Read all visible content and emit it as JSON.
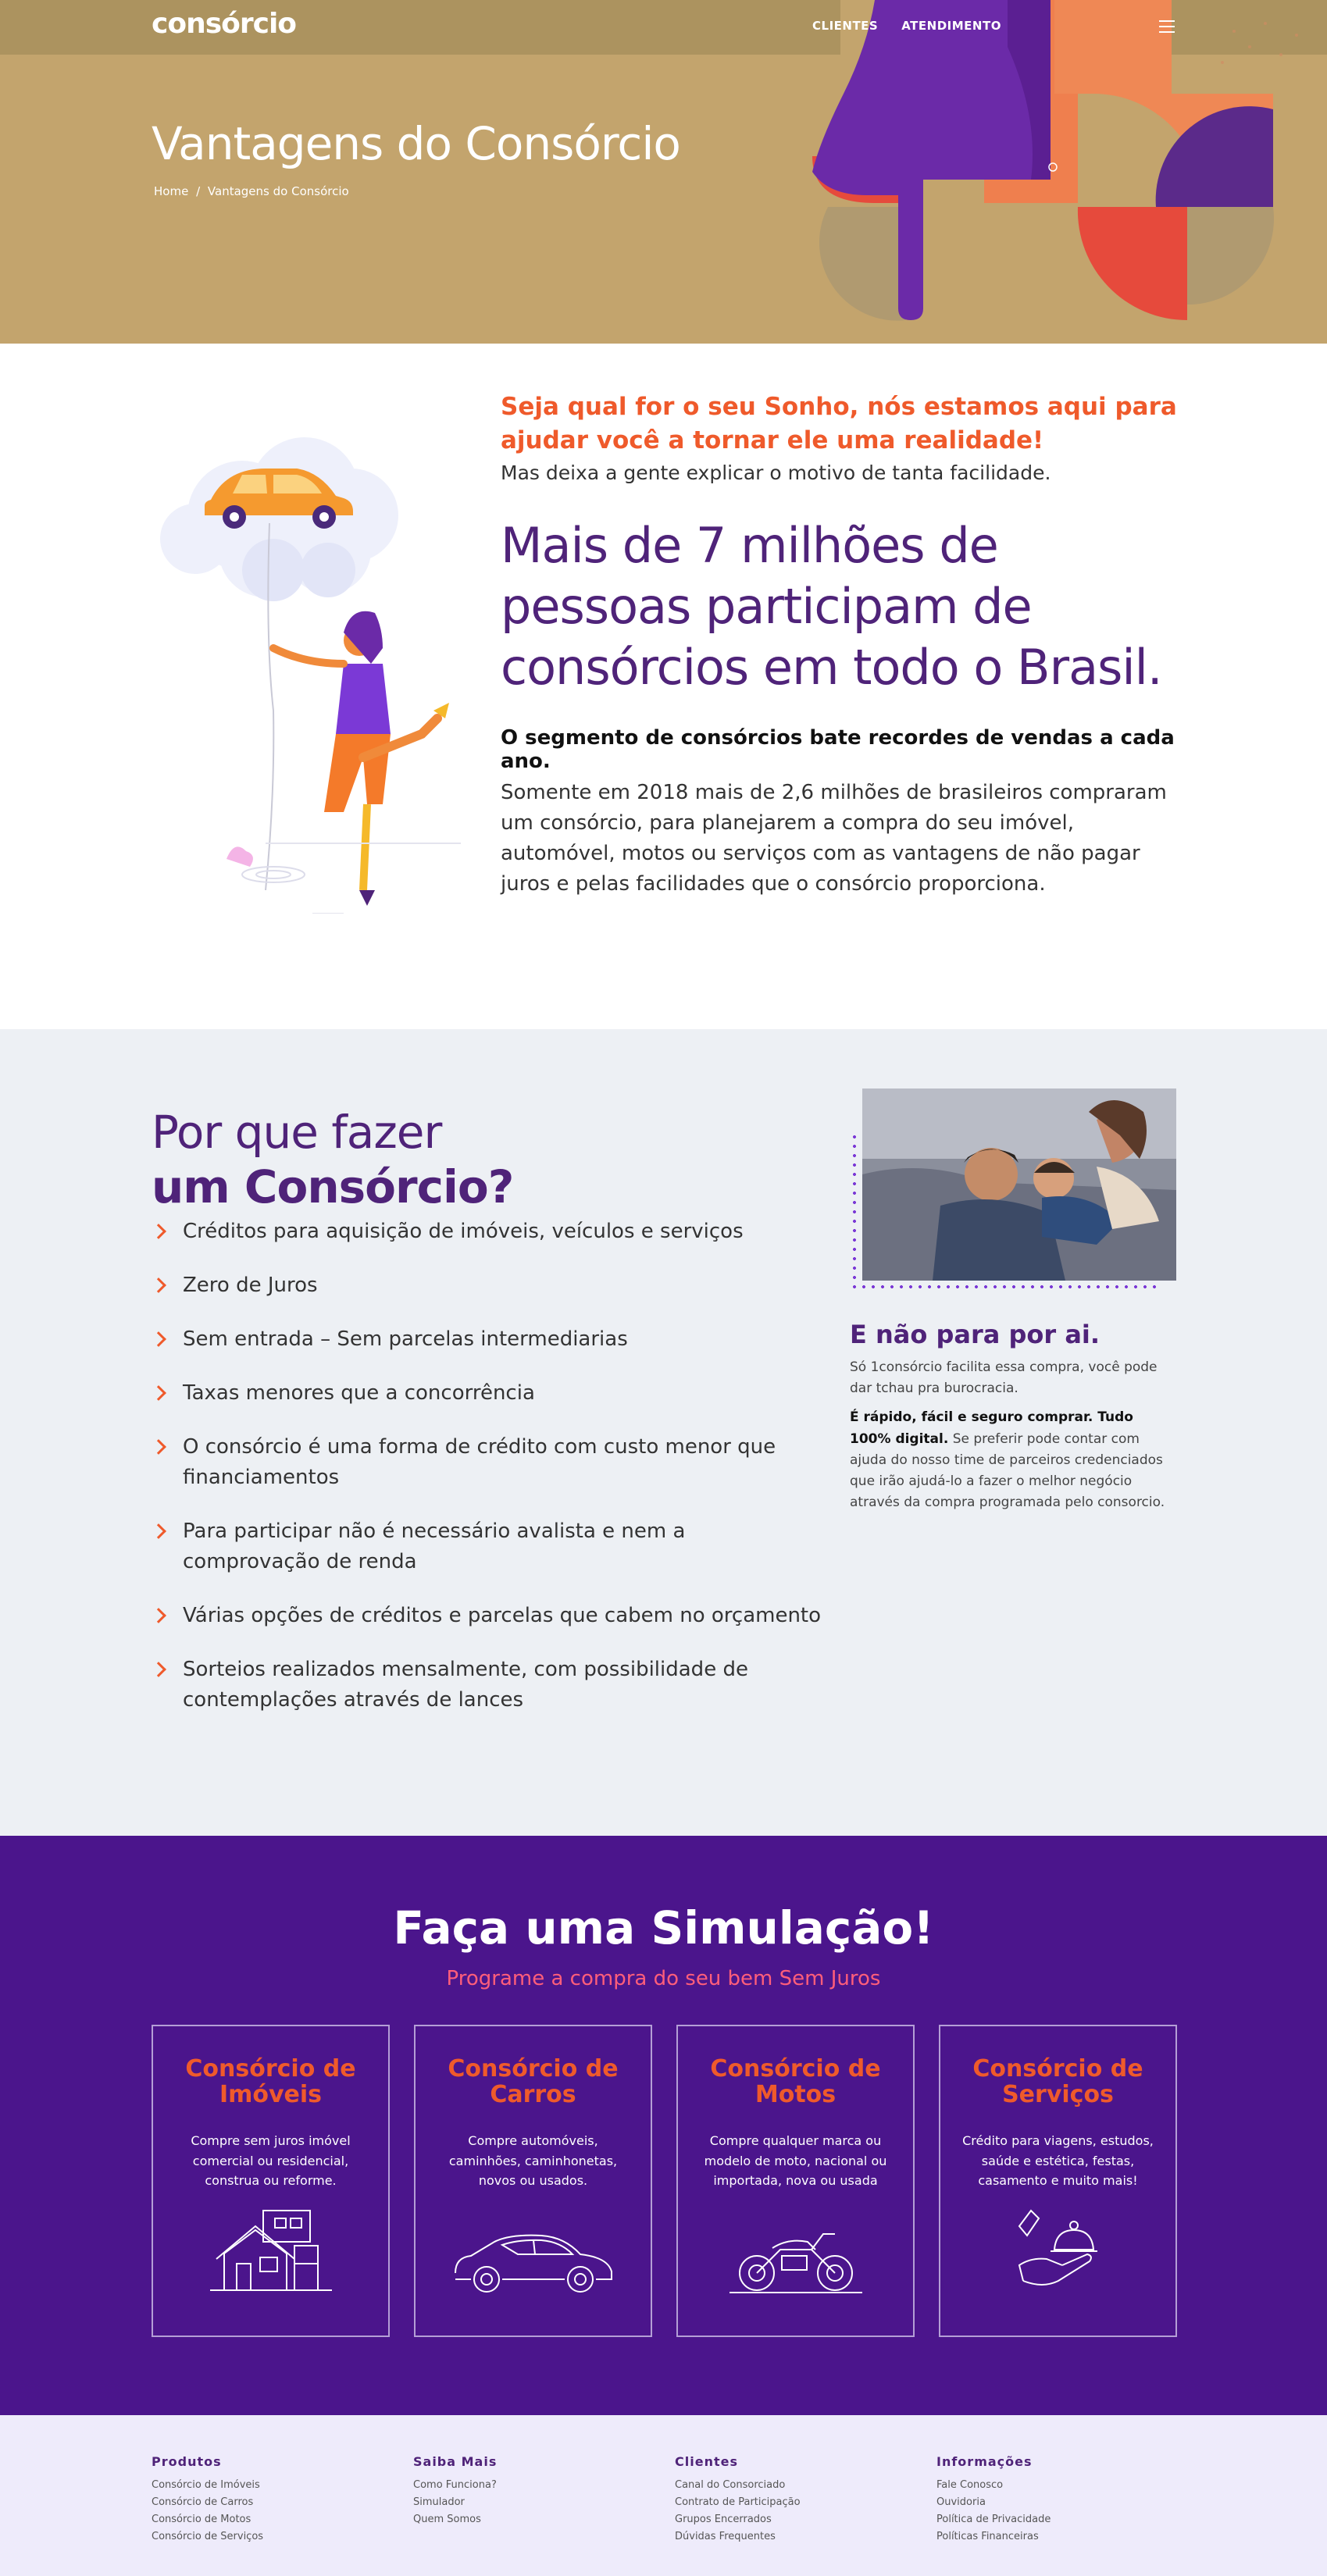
{
  "header": {
    "brand": "consórcio",
    "nav": [
      "CLIENTES",
      "ATENDIMENTO"
    ],
    "title": "Vantagens do Consórcio",
    "breadcrumb": {
      "home": "Home",
      "separator": "/",
      "current": "Vantagens do Consórcio"
    }
  },
  "intro": {
    "tagline": "Seja qual for o seu Sonho, nós estamos aqui para ajudar você a tornar ele uma realidade!",
    "subtitle": "Mas deixa a gente explicar o motivo de tanta facilidade.",
    "headline": "Mais de 7 milhões de pessoas participam de consórcios em todo o Brasil.",
    "lead": "O segmento de consórcios bate recordes de vendas a cada ano.",
    "body": "Somente em 2018 mais de 2,6 milhões de brasileiros compraram um consórcio, para planejarem a compra do seu imóvel, automóvel, motos ou serviços com as vantagens de não pagar juros e pelas facilidades que o consórcio proporciona."
  },
  "why": {
    "title_line1": "Por que fazer",
    "title_line2": "um Consórcio?",
    "items": [
      "Créditos para aquisição de imóveis, veículos e serviços",
      "Zero de Juros",
      "Sem entrada – Sem parcelas intermediarias",
      "Taxas menores que a concorrência",
      "O consórcio é uma forma de crédito com custo menor que financiamentos",
      "Para participar não é necessário avalista e nem a comprovação de renda",
      "Várias opções de créditos e parcelas que cabem no orçamento",
      "Sorteios realizados mensalmente, com possibilidade de contemplações através de lances"
    ],
    "side_title": "E não para por ai.",
    "side_p1": "Só 1consórcio facilita essa compra, você pode dar tchau pra burocracia.",
    "side_p2_bold": "É rápido, fácil e seguro comprar. Tudo 100% digital.",
    "side_p2_rest": " Se preferir pode contar com ajuda do nosso time de parceiros credenciados que irão ajudá-lo a fazer o melhor negócio através da compra programada pelo consorcio."
  },
  "simulation": {
    "title": "Faça uma Simulação!",
    "subtitle": "Programe a compra do seu bem Sem Juros",
    "cards": [
      {
        "title": "Consórcio de Imóveis",
        "text": "Compre sem juros imóvel comercial ou residencial, construa ou reforme.",
        "icon": "house-icon"
      },
      {
        "title": "Consórcio de Carros",
        "text": "Compre automóveis, caminhões, caminhonetas, novos ou usados.",
        "icon": "car-icon"
      },
      {
        "title": "Consórcio de Motos",
        "text": "Compre qualquer marca ou modelo de moto, nacional ou importada, nova ou usada",
        "icon": "motorcycle-icon"
      },
      {
        "title": "Consórcio de Serviços",
        "text": "Crédito para viagens, estudos, saúde e estética, festas, casamento e muito mais!",
        "icon": "service-bell-icon"
      }
    ]
  },
  "footer": {
    "columns": [
      {
        "title": "Produtos",
        "links": [
          "Consórcio de Imóveis",
          "Consórcio de Carros",
          "Consórcio de Motos",
          "Consórcio de Serviços"
        ]
      },
      {
        "title": "Saiba Mais",
        "links": [
          "Como Funciona?",
          "Simulador",
          "Quem Somos"
        ]
      },
      {
        "title": "Clientes",
        "links": [
          "Canal do Consorciado",
          "Contrato de Participação",
          "Grupos Encerrados",
          "Dúvidas Frequentes"
        ]
      },
      {
        "title": "Informações",
        "links": [
          "Fale Conosco",
          "Ouvidoria",
          "Política de Privacidade",
          "Políticas Financeiras"
        ]
      }
    ]
  },
  "colors": {
    "hero_bg": "#c3a46d",
    "accent_orange": "#ef5a2b",
    "brand_purple": "#4f2379",
    "simulation_bg": "#4b158c",
    "section_gray": "#edf0f4",
    "footer_bg": "#eeebfb"
  }
}
